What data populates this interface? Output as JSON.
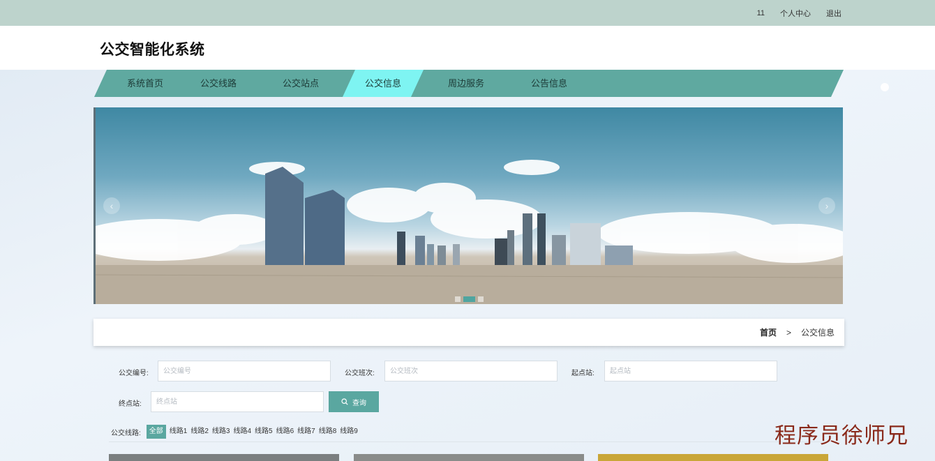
{
  "topbar": {
    "username": "11",
    "profile_link": "个人中心",
    "logout_link": "退出"
  },
  "header": {
    "title": "公交智能化系统"
  },
  "nav": {
    "items": [
      {
        "label": "系统首页"
      },
      {
        "label": "公交线路"
      },
      {
        "label": "公交站点"
      },
      {
        "label": "公交信息"
      },
      {
        "label": "周边服务"
      },
      {
        "label": "公告信息"
      }
    ],
    "active_index": 3
  },
  "banner": {
    "prev_icon": "chevron-left-icon",
    "next_icon": "chevron-right-icon",
    "slide_count": 3,
    "active_slide": 2
  },
  "breadcrumb": {
    "home": "首页",
    "separator": ">",
    "current": "公交信息"
  },
  "search": {
    "bus_no_label": "公交编号:",
    "bus_no_placeholder": "公交编号",
    "shift_label": "公交班次:",
    "shift_placeholder": "公交班次",
    "start_label": "起点站:",
    "start_placeholder": "起点站",
    "end_label": "终点站:",
    "end_placeholder": "终点站",
    "button_label": "查询",
    "button_icon": "search-icon"
  },
  "filter": {
    "label": "公交线路:",
    "options": [
      "全部",
      "线路1",
      "线路2",
      "线路3",
      "线路4",
      "线路5",
      "线路6",
      "线路7",
      "线路8",
      "线路9"
    ],
    "active_index": 0
  },
  "watermark": "程序员徐师兄",
  "colors": {
    "topbar": "#bdd3cc",
    "nav": "#5fa9a0",
    "nav_active": "#7ef4f2",
    "button": "#5aa7a0",
    "watermark": "#8a2a1b"
  }
}
